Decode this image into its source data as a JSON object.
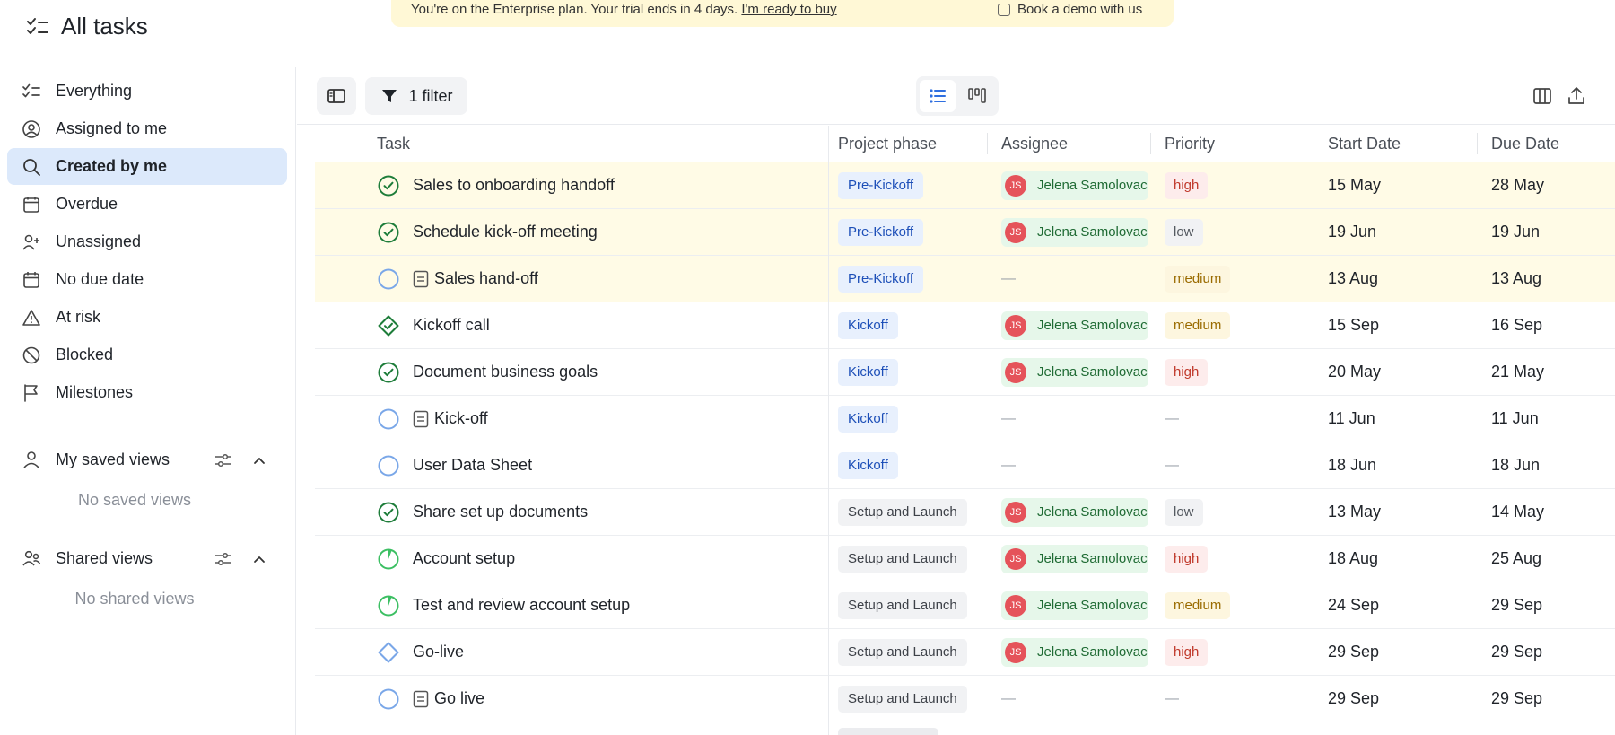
{
  "header": {
    "title": "All tasks",
    "banner_text": "You're on the Enterprise plan. Your trial ends in 4 days.",
    "banner_link": "I'm ready to buy",
    "banner_demo": "Book a demo with us"
  },
  "sidebar": {
    "items": [
      {
        "label": "Everything",
        "icon": "checklist-icon"
      },
      {
        "label": "Assigned to me",
        "icon": "user-circle-icon"
      },
      {
        "label": "Created by me",
        "icon": "search-icon"
      },
      {
        "label": "Overdue",
        "icon": "calendar-icon"
      },
      {
        "label": "Unassigned",
        "icon": "user-plus-icon"
      },
      {
        "label": "No due date",
        "icon": "calendar-icon"
      },
      {
        "label": "At risk",
        "icon": "warning-icon"
      },
      {
        "label": "Blocked",
        "icon": "blocked-icon"
      },
      {
        "label": "Milestones",
        "icon": "flag-icon"
      }
    ],
    "active_index": 2,
    "saved_views": {
      "label": "My saved views",
      "empty": "No saved views"
    },
    "shared_views": {
      "label": "Shared views",
      "empty": "No shared views"
    }
  },
  "toolbar": {
    "filter_label": "1 filter"
  },
  "table": {
    "columns": [
      "Task",
      "Project phase",
      "Assignee",
      "Priority",
      "Start Date",
      "Due Date"
    ],
    "rows": [
      {
        "status": "done",
        "doc": false,
        "task": "Sales to onboarding handoff",
        "phase": "Pre-Kickoff",
        "phase_style": "blue",
        "assignee": "Jelena Samolovac",
        "initials": "JS",
        "priority": "high",
        "start": "15 May",
        "due": "28 May",
        "highlight": true
      },
      {
        "status": "done",
        "doc": false,
        "task": "Schedule kick-off meeting",
        "phase": "Pre-Kickoff",
        "phase_style": "blue",
        "assignee": "Jelena Samolovac",
        "initials": "JS",
        "priority": "low",
        "start": "19 Jun",
        "due": "19 Jun",
        "highlight": true
      },
      {
        "status": "open",
        "doc": true,
        "task": "Sales hand-off",
        "phase": "Pre-Kickoff",
        "phase_style": "blue",
        "assignee": "",
        "initials": "",
        "priority": "medium",
        "start": "13 Aug",
        "due": "13 Aug",
        "highlight": true
      },
      {
        "status": "milestone-done",
        "doc": false,
        "task": "Kickoff call",
        "phase": "Kickoff",
        "phase_style": "blue",
        "assignee": "Jelena Samolovac",
        "initials": "JS",
        "priority": "medium",
        "start": "15 Sep",
        "due": "16 Sep",
        "highlight": false
      },
      {
        "status": "done",
        "doc": false,
        "task": "Document business goals",
        "phase": "Kickoff",
        "phase_style": "blue",
        "assignee": "Jelena Samolovac",
        "initials": "JS",
        "priority": "high",
        "start": "20 May",
        "due": "21 May",
        "highlight": false
      },
      {
        "status": "open",
        "doc": true,
        "task": "Kick-off",
        "phase": "Kickoff",
        "phase_style": "blue",
        "assignee": "",
        "initials": "",
        "priority": "",
        "start": "11 Jun",
        "due": "11 Jun",
        "highlight": false
      },
      {
        "status": "open",
        "doc": false,
        "task": "User Data Sheet",
        "phase": "Kickoff",
        "phase_style": "blue",
        "assignee": "",
        "initials": "",
        "priority": "",
        "start": "18 Jun",
        "due": "18 Jun",
        "highlight": false
      },
      {
        "status": "done",
        "doc": false,
        "task": "Share set up documents",
        "phase": "Setup and Launch",
        "phase_style": "gray",
        "assignee": "Jelena Samolovac",
        "initials": "JS",
        "priority": "low",
        "start": "13 May",
        "due": "14 May",
        "highlight": false
      },
      {
        "status": "in-progress",
        "doc": false,
        "task": "Account setup",
        "phase": "Setup and Launch",
        "phase_style": "gray",
        "assignee": "Jelena Samolovac",
        "initials": "JS",
        "priority": "high",
        "start": "18 Aug",
        "due": "25 Aug",
        "highlight": false
      },
      {
        "status": "in-progress",
        "doc": false,
        "task": "Test and review account setup",
        "phase": "Setup and Launch",
        "phase_style": "gray",
        "assignee": "Jelena Samolovac",
        "initials": "JS",
        "priority": "medium",
        "start": "24 Sep",
        "due": "29 Sep",
        "highlight": false
      },
      {
        "status": "milestone-open",
        "doc": false,
        "task": "Go-live",
        "phase": "Setup and Launch",
        "phase_style": "gray",
        "assignee": "Jelena Samolovac",
        "initials": "JS",
        "priority": "high",
        "start": "29 Sep",
        "due": "29 Sep",
        "highlight": false
      },
      {
        "status": "open",
        "doc": true,
        "task": "Go live",
        "phase": "Setup and Launch",
        "phase_style": "gray",
        "assignee": "",
        "initials": "",
        "priority": "",
        "start": "29 Sep",
        "due": "29 Sep",
        "highlight": false
      }
    ],
    "empty_marker": "—"
  },
  "colors": {
    "accent": "#2f6fe0",
    "done_green": "#1e7d3a",
    "open_blue": "#7aa7e8",
    "progress_green": "#3cbf63",
    "high": "#c0392b",
    "medium": "#9a6b00",
    "low": "#555a61"
  }
}
